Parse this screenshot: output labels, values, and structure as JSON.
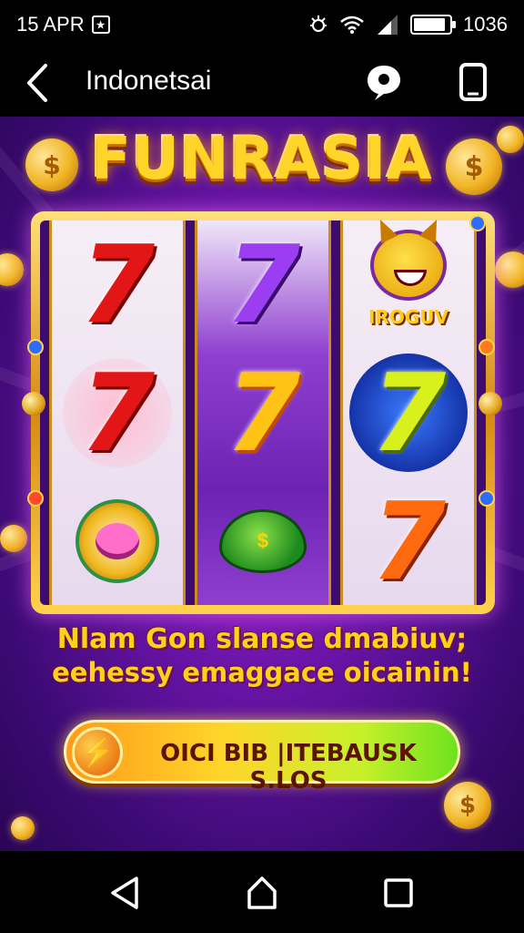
{
  "status_bar": {
    "date": "15 APR",
    "time": "1036",
    "battery_level": 0.9
  },
  "app_bar": {
    "title": "Indonetsai"
  },
  "game": {
    "logo": "FUNRASIA",
    "mascot_label": "IROGUV",
    "seven_symbol": "7",
    "promo_line1": "Nlam Gon slanse dmabiuv;",
    "promo_line2": "eehessy emaggace oicainin!",
    "cta_label": "OICI BIB |ITEBAUSK S.LOS",
    "accent_color": "#ffd52a",
    "background_color": "#6a14a8"
  },
  "icons": {
    "back": "back-arrow-icon",
    "chat": "chat-bubble-icon",
    "phone": "phone-icon",
    "nav_back": "nav-back-triangle-icon",
    "nav_home": "nav-home-icon",
    "nav_recent": "nav-recent-square-icon"
  }
}
